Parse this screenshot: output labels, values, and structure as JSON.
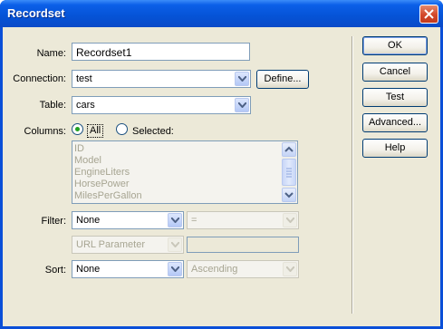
{
  "window": {
    "title": "Recordset"
  },
  "form": {
    "name_label": "Name:",
    "name_value": "Recordset1",
    "connection_label": "Connection:",
    "connection_value": "test",
    "define_label": "Define...",
    "table_label": "Table:",
    "table_value": "cars",
    "columns_label": "Columns:",
    "columns_all_label": "All",
    "columns_selected_label": "Selected:",
    "columns_list": [
      "ID",
      "Model",
      "EngineLiters",
      "HorsePower",
      "MilesPerGallon"
    ],
    "filter_label": "Filter:",
    "filter_value": "None",
    "filter_operator": "=",
    "filter_param_type": "URL Parameter",
    "filter_param_value": "",
    "sort_label": "Sort:",
    "sort_value": "None",
    "sort_order": "Ascending"
  },
  "buttons": {
    "ok": "OK",
    "cancel": "Cancel",
    "test": "Test",
    "advanced": "Advanced...",
    "help": "Help"
  }
}
